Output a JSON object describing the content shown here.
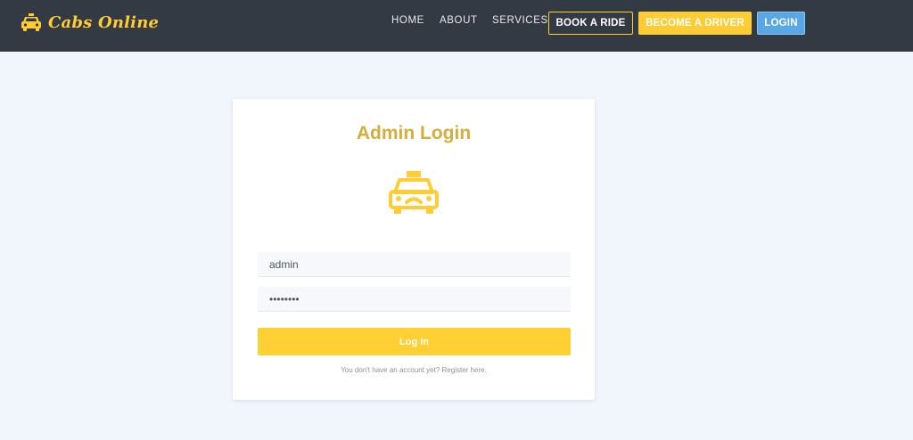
{
  "nav": {
    "brand": "Cabs Online",
    "brand_icon": "taxi-icon",
    "links": [
      "HOME",
      "ABOUT",
      "SERVICES"
    ],
    "book_ride": "BOOK A RIDE",
    "become_driver": "BECOME A DRIVER",
    "login": "LOGIN"
  },
  "login_card": {
    "title": "Admin Login",
    "icon": "taxi-icon",
    "username_value": "admin",
    "password_value": "12345678",
    "submit_label": "Log In",
    "register_prefix": "You don't have an account yet? ",
    "register_link": "Register here."
  },
  "colors": {
    "navbar_bg": "#333a43",
    "brand_yellow": "#ffcc33",
    "title_gold": "#d4ad3a",
    "login_blue": "#5aa7e6",
    "page_bg": "#f1f6fd"
  }
}
